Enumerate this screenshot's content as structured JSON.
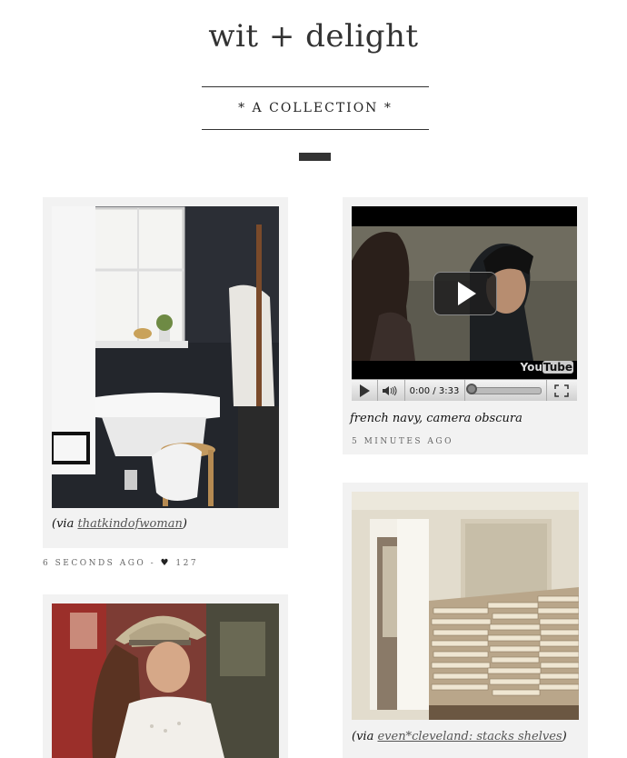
{
  "site": {
    "title": "wit + delight",
    "subtitle": "* A COLLECTION *"
  },
  "posts": [
    {
      "caption_prefix": "(via ",
      "caption_link": "thatkindofwoman",
      "caption_suffix": ")",
      "time": "6 SECONDS AGO",
      "separator": " - ",
      "likes": "127",
      "heart_icon": "heart-icon"
    },
    {
      "caption": "french navy, camera obscura",
      "time": "5 MINUTES AGO",
      "video": {
        "time": "0:00 / 3:33",
        "brand_you": "You",
        "brand_tube": "Tube"
      }
    },
    {
      "caption_prefix": "(via ",
      "caption_link": "even*cleveland: stacks shelves",
      "caption_suffix": ")"
    },
    {
      "image": "woman-in-hat-photo"
    }
  ]
}
